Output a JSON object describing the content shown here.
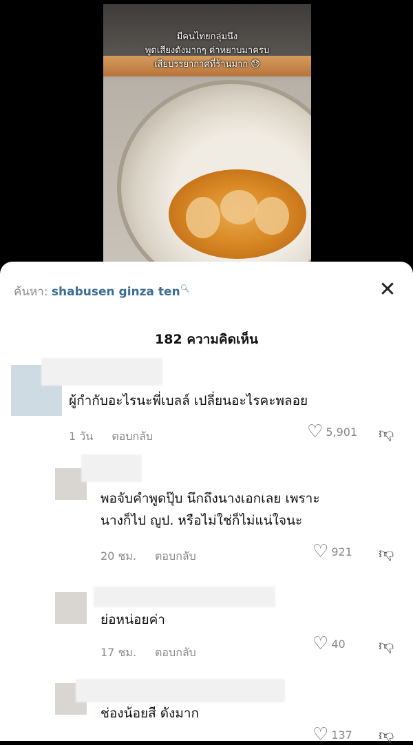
{
  "video": {
    "caption_lines": [
      "มีคนไทยกลุ่มนึง",
      "พูดเสียงดังมากๆ ด่าหยาบมาครบ",
      "เสียบรรยากาศที่ร้านมาก 😓"
    ]
  },
  "search": {
    "prefix": "ค้นหา:",
    "term": "shabusen ginza ten",
    "icon": "search-icon"
  },
  "header": {
    "count_title": "182 ความคิดเห็น",
    "close_icon": "close-icon"
  },
  "comments": [
    {
      "text": "ผู้กำกับอะไรนะพี่เบลล์ เปลี่ยนอะไรคะพลอย",
      "time": "1 วัน",
      "reply_label": "ตอบกลับ",
      "likes": "5,901"
    },
    {
      "text_line1": "พอจับคำพูดปุ๊บ นึกถึงนางเอกเลย เพราะ",
      "text_line2": "นางก็ไป ญูป. หรือไม่ใช่ก็ไม่แน่ใจนะ",
      "time": "20 ชม.",
      "reply_label": "ตอบกลับ",
      "likes": "921"
    },
    {
      "text": "ย่อหน่อยค่า",
      "time": "17 ชม.",
      "reply_label": "ตอบกลับ",
      "likes": "40"
    },
    {
      "text": "ช่องน้อยสี ดังมาก",
      "likes": "137"
    }
  ]
}
